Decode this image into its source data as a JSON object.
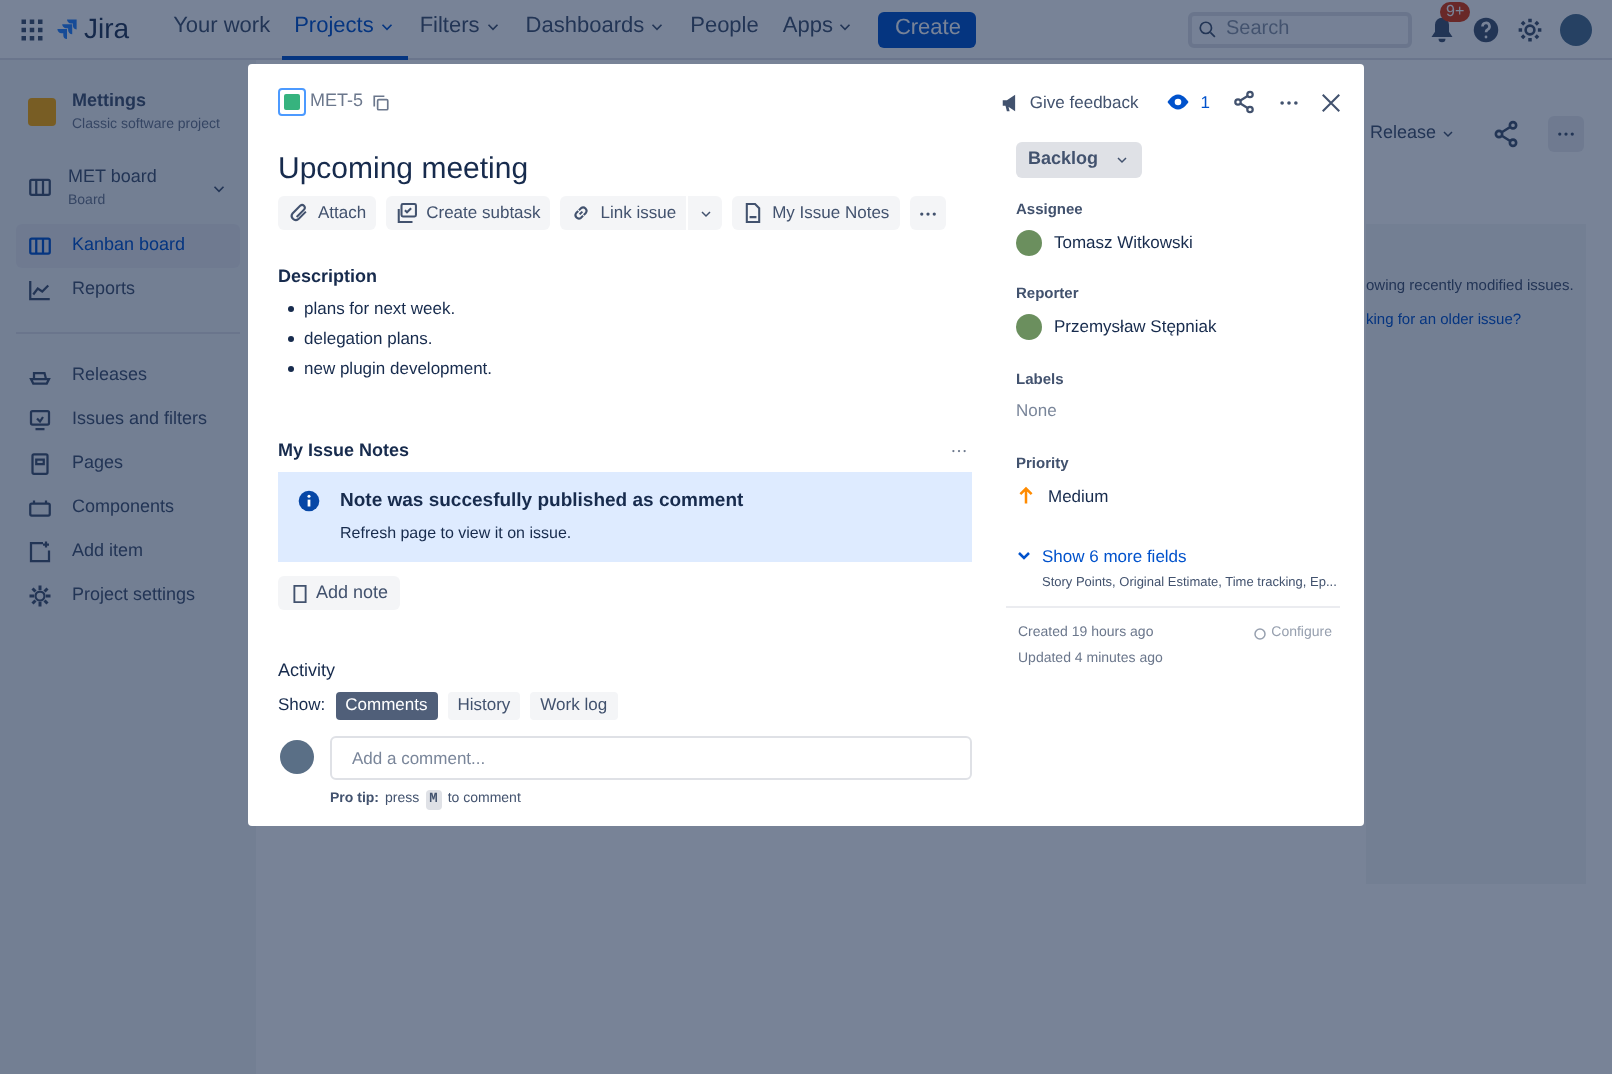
{
  "topbar": {
    "app_name": "Jira",
    "nav": [
      {
        "label": "Your work",
        "dropdown": false,
        "selected": false
      },
      {
        "label": "Projects",
        "dropdown": true,
        "selected": true
      },
      {
        "label": "Filters",
        "dropdown": true,
        "selected": false
      },
      {
        "label": "Dashboards",
        "dropdown": true,
        "selected": false
      },
      {
        "label": "People",
        "dropdown": false,
        "selected": false
      },
      {
        "label": "Apps",
        "dropdown": true,
        "selected": false
      }
    ],
    "create": "Create",
    "search_placeholder": "Search",
    "notification_badge": "9+"
  },
  "sidebar": {
    "project": {
      "name": "Mettings",
      "type": "Classic software project"
    },
    "board": {
      "name": "MET board",
      "type": "Board"
    },
    "items": [
      {
        "label": "Kanban board",
        "selected": true
      },
      {
        "label": "Reports",
        "selected": false
      }
    ],
    "items_2": [
      {
        "label": "Releases",
        "selected": false
      },
      {
        "label": "Issues and filters",
        "selected": false
      },
      {
        "label": "Pages",
        "selected": false
      },
      {
        "label": "Components",
        "selected": false
      },
      {
        "label": "Add item",
        "selected": false
      },
      {
        "label": "Project settings",
        "selected": false
      }
    ]
  },
  "background": {
    "release_button": "Release",
    "notice": "owing recently modified issues.",
    "link": "king for an older issue?"
  },
  "modal": {
    "issue_key": "MET-5",
    "feedback": "Give feedback",
    "watchers": "1",
    "title": "Upcoming meeting",
    "actions": [
      {
        "label": "Attach",
        "kind": "attach"
      },
      {
        "label": "Create subtask",
        "kind": "subtask"
      },
      {
        "label": "Link issue",
        "kind": "link"
      },
      {
        "label": "My Issue Notes",
        "kind": "notes"
      }
    ],
    "description": {
      "heading": "Description",
      "items": [
        "plans for next week.",
        "delegation plans.",
        "new plugin development."
      ]
    },
    "notes": {
      "heading": "My Issue Notes",
      "banner_title": "Note was succesfully published as comment",
      "banner_body": "Refresh page to view it on issue.",
      "add_note": "Add note"
    },
    "activity": {
      "heading": "Activity",
      "show_label": "Show:",
      "filters": [
        {
          "label": "Comments",
          "selected": true
        },
        {
          "label": "History",
          "selected": false
        },
        {
          "label": "Work log",
          "selected": false
        }
      ],
      "comment_placeholder": "Add a comment...",
      "pro_tip": {
        "label": "Pro tip:",
        "before": "press",
        "key": "M",
        "after": "to comment"
      }
    },
    "status": "Backlog",
    "fields": [
      {
        "label": "Assignee",
        "value": "Tomasz Witkowski",
        "kind": "person"
      },
      {
        "label": "Reporter",
        "value": "Przemysław Stępniak",
        "kind": "person"
      },
      {
        "label": "Labels",
        "value": "None",
        "kind": "empty"
      },
      {
        "label": "Priority",
        "value": "Medium",
        "kind": "priority"
      }
    ],
    "more_fields": {
      "label": "Show 6 more fields",
      "summary": "Story Points, Original Estimate, Time tracking, Ep..."
    },
    "created": "Created 19 hours ago",
    "updated": "Updated 4 minutes ago",
    "configure": "Configure"
  }
}
